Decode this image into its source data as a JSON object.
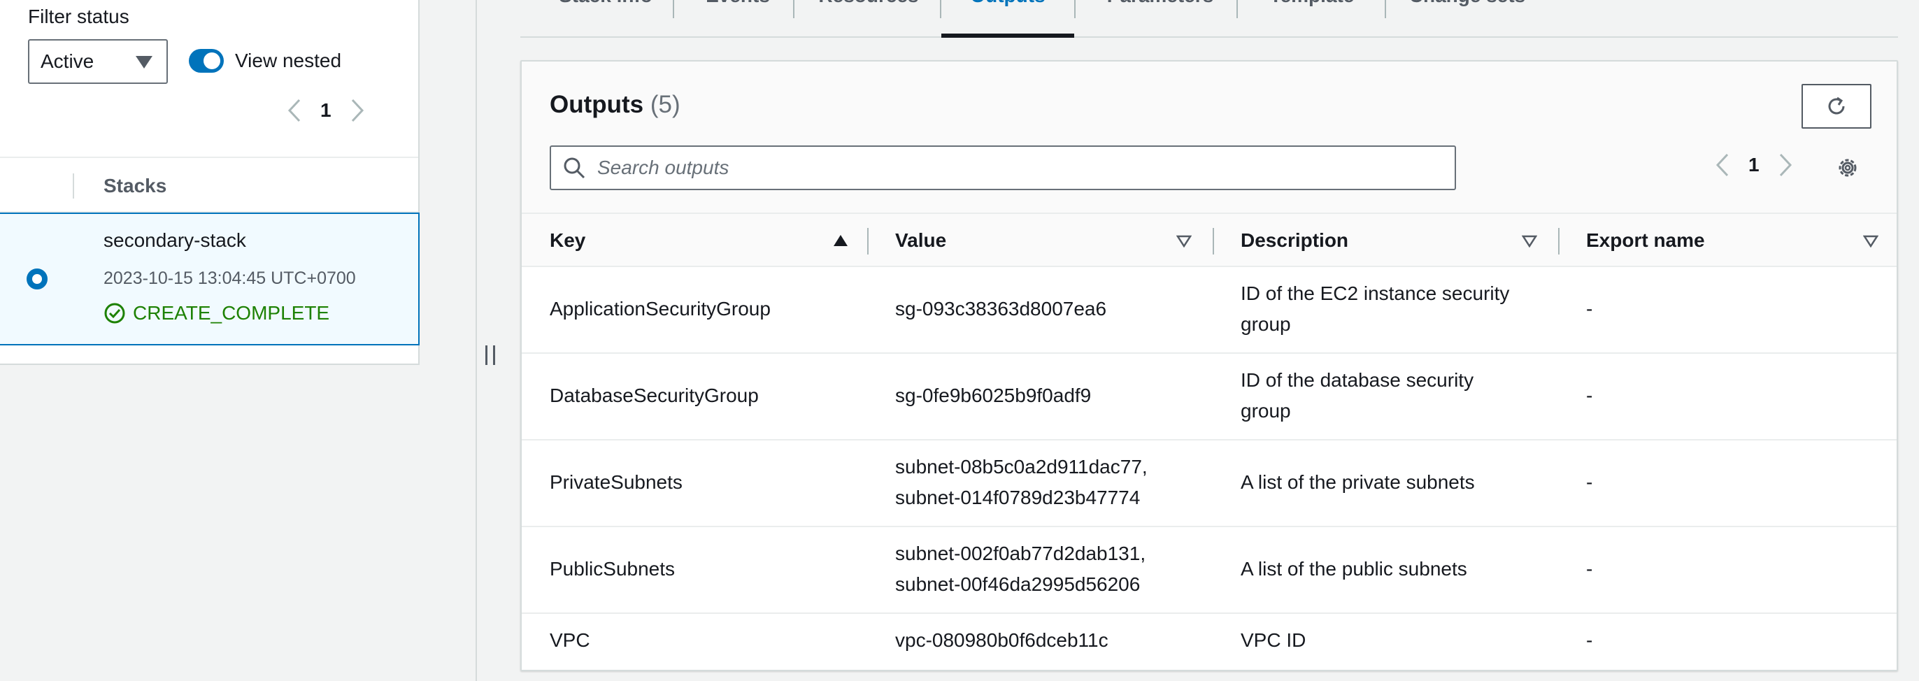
{
  "filter": {
    "label": "Filter status",
    "selected": "Active",
    "view_nested_label": "View nested",
    "view_nested_on": true
  },
  "left_pager": {
    "page": "1"
  },
  "stacks": {
    "column_header": "Stacks",
    "items": [
      {
        "name": "secondary-stack",
        "date": "2023-10-15 13:04:45 UTC+0700",
        "status": "CREATE_COMPLETE",
        "selected": true
      }
    ]
  },
  "tabs": [
    {
      "label": "Stack info"
    },
    {
      "label": "Events"
    },
    {
      "label": "Resources"
    },
    {
      "label": "Outputs",
      "active": true
    },
    {
      "label": "Parameters"
    },
    {
      "label": "Template"
    },
    {
      "label": "Change sets"
    }
  ],
  "outputs": {
    "title": "Outputs",
    "count": "(5)",
    "search_placeholder": "Search outputs",
    "page": "1",
    "columns": {
      "key": "Key",
      "value": "Value",
      "description": "Description",
      "export_name": "Export name"
    },
    "rows": [
      {
        "key": "ApplicationSecurityGroup",
        "value_lines": [
          "sg-093c38363d8007ea6"
        ],
        "description_lines": [
          "ID of the EC2 instance security",
          "group"
        ],
        "export_name": "-"
      },
      {
        "key": "DatabaseSecurityGroup",
        "value_lines": [
          "sg-0fe9b6025b9f0adf9"
        ],
        "description_lines": [
          "ID of the database security",
          "group"
        ],
        "export_name": "-"
      },
      {
        "key": "PrivateSubnets",
        "value_lines": [
          "subnet-08b5c0a2d911dac77,",
          "subnet-014f0789d23b47774"
        ],
        "description_lines": [
          "A list of the private subnets"
        ],
        "export_name": "-"
      },
      {
        "key": "PublicSubnets",
        "value_lines": [
          "subnet-002f0ab77d2dab131,",
          "subnet-00f46da2995d56206"
        ],
        "description_lines": [
          "A list of the public subnets"
        ],
        "export_name": "-"
      },
      {
        "key": "VPC",
        "value_lines": [
          "vpc-080980b0f6dceb11c"
        ],
        "description_lines": [
          "VPC ID"
        ],
        "export_name": "-"
      }
    ]
  },
  "colors": {
    "accent": "#0073bb",
    "success": "#1d8102",
    "selected_row_bg": "#f1faff"
  },
  "icons": {
    "caret": "caret-down-icon",
    "prev": "chevron-left-icon",
    "next": "chevron-right-icon",
    "refresh": "refresh-icon",
    "search": "search-icon",
    "settings": "gear-icon",
    "status_ok": "check-circle-icon",
    "sort_asc": "sort-ascending-icon",
    "sort": "sort-icon"
  }
}
